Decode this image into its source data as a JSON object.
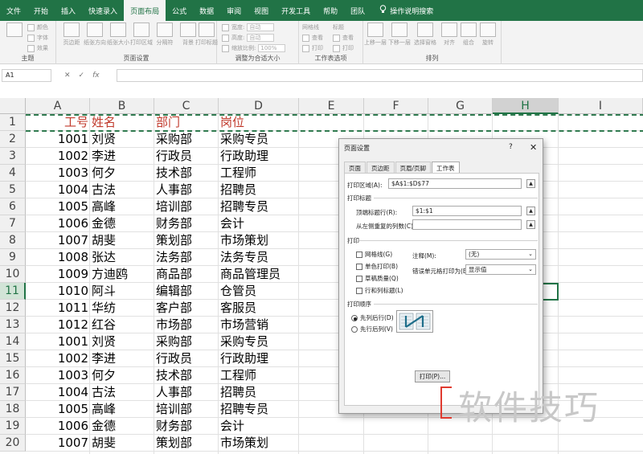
{
  "ribbon": {
    "tabs": [
      "文件",
      "开始",
      "插入",
      "快速录入",
      "页面布局",
      "公式",
      "数据",
      "审阅",
      "视图",
      "开发工具",
      "帮助",
      "团队"
    ],
    "active_tab": "页面布局",
    "tell_me": "操作说明搜索",
    "groups": {
      "theme": "主题",
      "page_setup": "页面设置",
      "scale": "调整为合适大小",
      "sheet_options": "工作表选项",
      "arrange": "排列"
    },
    "theme_small": [
      "颜色",
      "字体",
      "效果"
    ],
    "page_setup_buttons": [
      "页边距",
      "纸张方向",
      "纸张大小",
      "打印区域",
      "分隔符",
      "背景",
      "打印标题"
    ],
    "scale_rows": [
      {
        "label": "宽度:",
        "value": "自动"
      },
      {
        "label": "高度:",
        "value": "自动"
      },
      {
        "label": "缩放比例:",
        "value": "100%"
      }
    ],
    "sheet_opts": {
      "gridlines": "网格线",
      "headings": "标题",
      "view": "查看",
      "print": "打印"
    },
    "arrange_buttons": [
      "上移一层",
      "下移一层",
      "选择窗格",
      "对齐",
      "组合",
      "旋转"
    ]
  },
  "formula_bar": {
    "namebox": "A1",
    "cancel": "✕",
    "confirm": "✓",
    "fx": "fx",
    "value": ""
  },
  "sheet": {
    "columns": [
      "A",
      "B",
      "C",
      "D",
      "E",
      "F",
      "G",
      "H",
      "I"
    ],
    "selected_column": "H",
    "selected_row": "11",
    "rows": [
      {
        "n": "1",
        "a": "工号",
        "b": "姓名",
        "c": "部门",
        "d": "岗位",
        "header": true
      },
      {
        "n": "2",
        "a": "1001",
        "b": "刘贤",
        "c": "采购部",
        "d": "采购专员"
      },
      {
        "n": "3",
        "a": "1002",
        "b": "李进",
        "c": "行政员",
        "d": "行政助理"
      },
      {
        "n": "4",
        "a": "1003",
        "b": "何夕",
        "c": "技术部",
        "d": "工程师"
      },
      {
        "n": "5",
        "a": "1004",
        "b": "古法",
        "c": "人事部",
        "d": "招聘员"
      },
      {
        "n": "6",
        "a": "1005",
        "b": "高峰",
        "c": "培训部",
        "d": "招聘专员"
      },
      {
        "n": "7",
        "a": "1006",
        "b": "金德",
        "c": "财务部",
        "d": "会计"
      },
      {
        "n": "8",
        "a": "1007",
        "b": "胡斐",
        "c": "策划部",
        "d": "市场策划"
      },
      {
        "n": "9",
        "a": "1008",
        "b": "张达",
        "c": "法务部",
        "d": "法务专员"
      },
      {
        "n": "10",
        "a": "1009",
        "b": "方迪鸥",
        "c": "商品部",
        "d": "商品管理员"
      },
      {
        "n": "11",
        "a": "1010",
        "b": "阿斗",
        "c": "编辑部",
        "d": "仓管员"
      },
      {
        "n": "12",
        "a": "1011",
        "b": "华纺",
        "c": "客户部",
        "d": "客服员"
      },
      {
        "n": "13",
        "a": "1012",
        "b": "红谷",
        "c": "市场部",
        "d": "市场营销"
      },
      {
        "n": "14",
        "a": "1001",
        "b": "刘贤",
        "c": "采购部",
        "d": "采购专员"
      },
      {
        "n": "15",
        "a": "1002",
        "b": "李进",
        "c": "行政员",
        "d": "行政助理"
      },
      {
        "n": "16",
        "a": "1003",
        "b": "何夕",
        "c": "技术部",
        "d": "工程师"
      },
      {
        "n": "17",
        "a": "1004",
        "b": "古法",
        "c": "人事部",
        "d": "招聘员"
      },
      {
        "n": "18",
        "a": "1005",
        "b": "高峰",
        "c": "培训部",
        "d": "招聘专员"
      },
      {
        "n": "19",
        "a": "1006",
        "b": "金德",
        "c": "财务部",
        "d": "会计"
      },
      {
        "n": "20",
        "a": "1007",
        "b": "胡斐",
        "c": "策划部",
        "d": "市场策划"
      }
    ]
  },
  "dialog": {
    "title": "页面设置",
    "help": "?",
    "close": "✕",
    "tabs": [
      "页面",
      "页边距",
      "页眉/页脚",
      "工作表"
    ],
    "active_tab": "工作表",
    "print_area_label": "打印区域(A):",
    "print_area_value": "$A$1:$D$77",
    "print_titles_label": "打印标题",
    "top_rows_label": "顶端标题行(R):",
    "top_rows_value": "$1:$1",
    "left_cols_label": "从左侧重复的列数(C):",
    "left_cols_value": "",
    "print_section_label": "打印",
    "checks": [
      "网格线(G)",
      "单色打印(B)",
      "草稿质量(Q)",
      "行和列标题(L)"
    ],
    "comments_label": "注释(M):",
    "comments_value": "(无)",
    "errors_label": "错误单元格打印为(E):",
    "errors_value": "显示值",
    "order_label": "打印顺序",
    "order_options": [
      "先列后行(D)",
      "先行后列(V)"
    ],
    "order_selected": 0,
    "print_button": "打印(P)..."
  },
  "watermark": "软件技巧",
  "colors": {
    "ribbon_green": "#217346",
    "header_text": "#c0392b",
    "page_break": "#2f7a4f"
  }
}
